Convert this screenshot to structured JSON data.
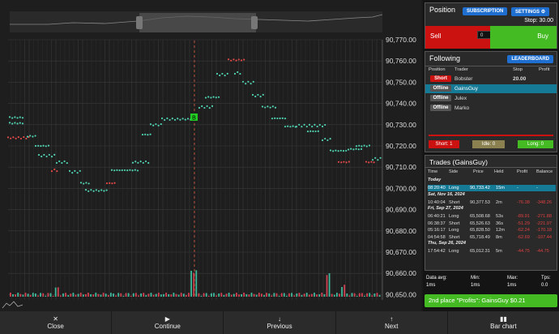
{
  "chart": {
    "y_ticks": [
      "90,770.00",
      "90,760.00",
      "90,750.00",
      "90,740.00",
      "90,730.00",
      "90,720.00",
      "90,710.00",
      "90,700.00",
      "90,690.00",
      "90,680.00",
      "90,670.00",
      "90,660.00",
      "90,650.00"
    ],
    "marker_label": "B"
  },
  "position": {
    "title": "Position",
    "subscription_label": "SUBSCRIPTION",
    "settings_label": "SETTINGS",
    "stop_label": "Stop: 30.00",
    "sell_label": "Sell",
    "buy_label": "Buy",
    "quantity_value": "0"
  },
  "following": {
    "title": "Following",
    "leaderboard_label": "LEADERBOARD",
    "columns": [
      "Position",
      "Trader",
      "Stop",
      "Profit"
    ],
    "rows": [
      {
        "status": "Short",
        "trader": "Bobster",
        "stop": "20.00",
        "profit": ""
      },
      {
        "status": "Offline",
        "trader": "GainsGuy",
        "stop": "",
        "profit": ""
      },
      {
        "status": "Offline",
        "trader": "Julex",
        "stop": "",
        "profit": ""
      },
      {
        "status": "Offline",
        "trader": "Marko",
        "stop": "",
        "profit": ""
      }
    ],
    "short_count": "Short: 1",
    "idle_count": "Idle: 0",
    "long_count": "Long: 0"
  },
  "trades": {
    "title": "Trades (GainsGuy)",
    "columns": [
      "Time",
      "Side",
      "Price",
      "Held",
      "Profit",
      "Balance"
    ],
    "groups": [
      {
        "date": "Today",
        "rows": [
          {
            "time": "08:20:40",
            "side": "Long",
            "price": "90,733.42",
            "held": "15m",
            "profit": "-",
            "balance": "-"
          }
        ]
      },
      {
        "date": "Sat, Nov 16, 2024",
        "rows": [
          {
            "time": "10:40:04",
            "side": "Short",
            "price": "90,377.53",
            "held": "2m",
            "profit": "-76.38",
            "balance": "-348.26"
          }
        ]
      },
      {
        "date": "Fri, Sep 27, 2024",
        "rows": [
          {
            "time": "06:40:21",
            "side": "Long",
            "price": "65,508.68",
            "held": "53s",
            "profit": "-89.91",
            "balance": "-271.88"
          },
          {
            "time": "06:38:37",
            "side": "Short",
            "price": "65,526.63",
            "held": "36s",
            "profit": "-51.29",
            "balance": "-221.97"
          },
          {
            "time": "05:16:17",
            "side": "Long",
            "price": "65,828.50",
            "held": "12m",
            "profit": "-62.24",
            "balance": "-170.18"
          },
          {
            "time": "04:54:58",
            "side": "Short",
            "price": "65,718.49",
            "held": "8m",
            "profit": "-62.69",
            "balance": "-107.44"
          }
        ]
      },
      {
        "date": "Thu, Sep 26, 2024",
        "rows": [
          {
            "time": "17:54:42",
            "side": "Long",
            "price": "65,012.31",
            "held": "5m",
            "profit": "-44.75",
            "balance": "-44.75"
          }
        ]
      }
    ]
  },
  "stats": {
    "data_avg_label": "Data avg:",
    "data_avg_value": "1ms",
    "min_label": "Min:",
    "min_value": "1ms",
    "max_label": "Max:",
    "max_value": "1ms",
    "tps_label": "Tps:",
    "tps_value": "0.0"
  },
  "banner": "2nd place \"Profits\": GainsGuy $0.21",
  "bottom": {
    "close": "Close",
    "continue": "Continue",
    "previous": "Previous",
    "next": "Next",
    "bar_chart": "Bar chart"
  }
}
